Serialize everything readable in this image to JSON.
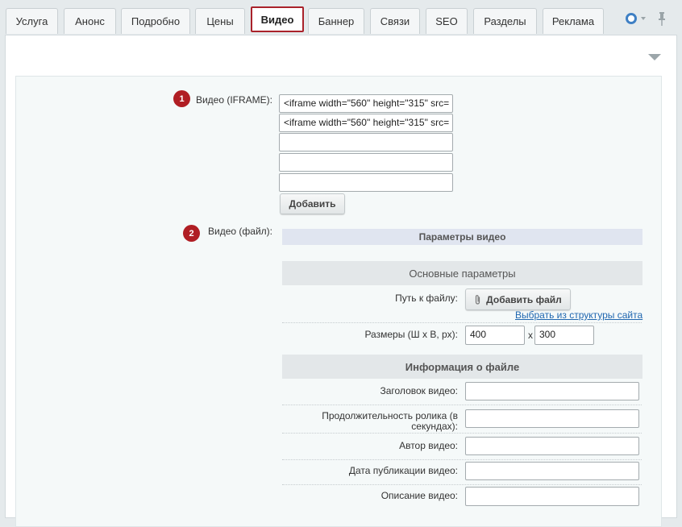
{
  "tabs": [
    {
      "label": "Услуга"
    },
    {
      "label": "Анонс"
    },
    {
      "label": "Подробно"
    },
    {
      "label": "Цены"
    },
    {
      "label": "Видео",
      "active": true
    },
    {
      "label": "Баннер"
    },
    {
      "label": "Связи"
    },
    {
      "label": "SEO"
    },
    {
      "label": "Разделы"
    },
    {
      "label": "Реклама"
    }
  ],
  "colors": {
    "active_tab_border": "#a9222a",
    "badge": "#b01e24",
    "link": "#2067b0",
    "gear": "#3f80c4"
  },
  "toolbar": {
    "settings_icon": "gear-icon",
    "pin_icon": "pin-icon",
    "collapse_icon": "chevron-down-icon"
  },
  "iframe_field": {
    "badge": "1",
    "label": "Видео (IFRAME):",
    "values": [
      "<iframe width=\"560\" height=\"315\" src=",
      "<iframe width=\"560\" height=\"315\" src=",
      "",
      "",
      ""
    ],
    "add_label": "Добавить"
  },
  "file_field": {
    "badge": "2",
    "label": "Видео (файл):",
    "params_title": "Параметры видео",
    "basic_title": "Основные параметры",
    "path_label": "Путь к файлу:",
    "add_file_label": "Добавить файл",
    "choose_link": "Выбрать из структуры сайта",
    "size_label": "Размеры (Ш х В, px):",
    "width": "400",
    "height": "300",
    "size_sep": "x",
    "info_title": "Информация о файле",
    "title_label": "Заголовок видео:",
    "duration_label": "Продолжительность ролика (в секундах):",
    "author_label": "Автор видео:",
    "date_label": "Дата публикации видео:",
    "desc_label": "Описание видео:"
  }
}
